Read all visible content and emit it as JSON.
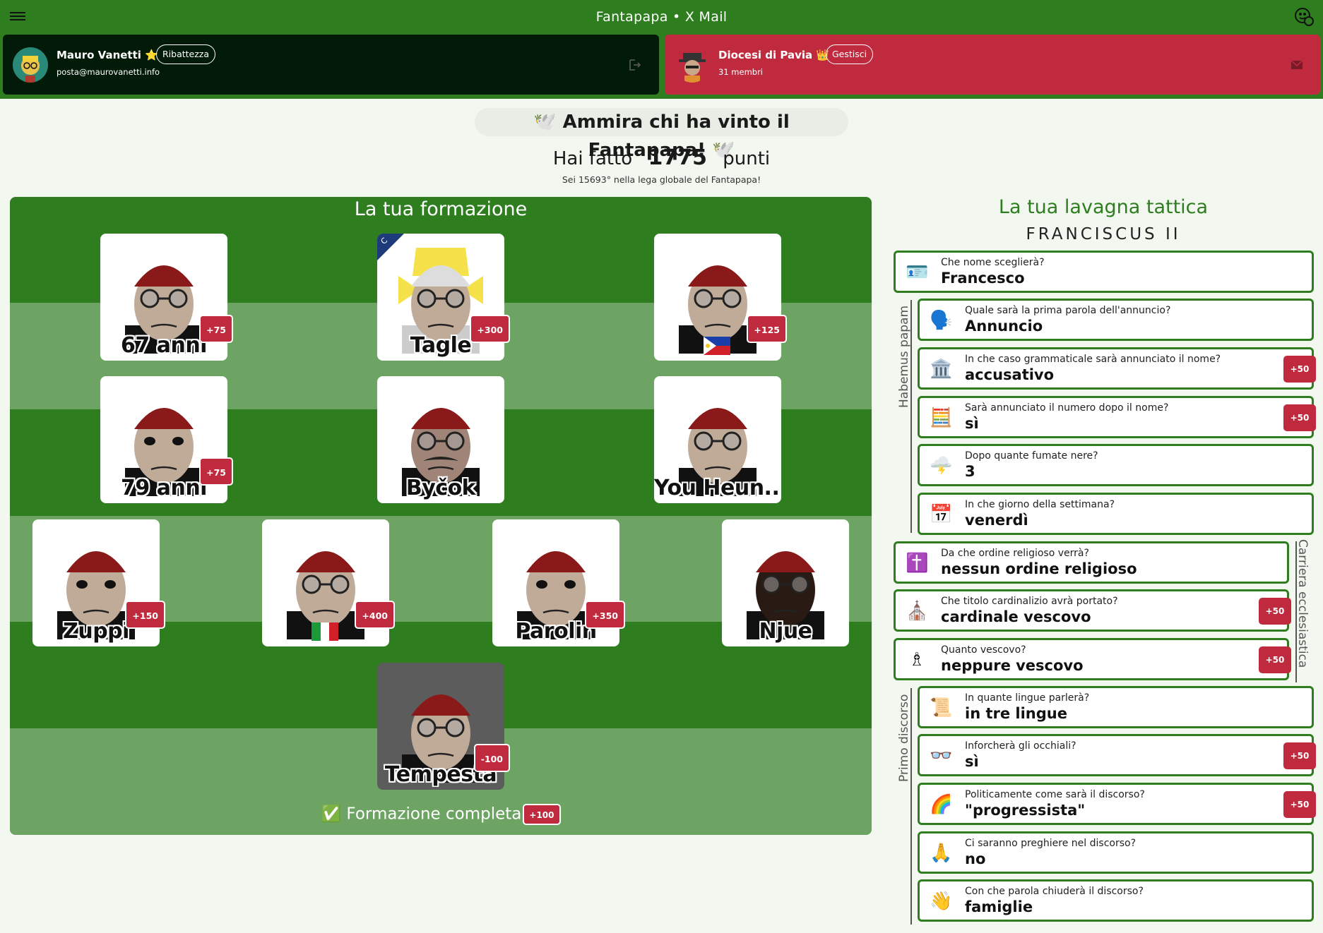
{
  "header": {
    "title": "Fantapapa • X Mail"
  },
  "user": {
    "name": "Mauro Vanetti ⭐",
    "email": "posta@maurovanetti.info",
    "action_label": "Ribattezza"
  },
  "league": {
    "name": "Diocesi di Pavia 👑",
    "members": "31 membri",
    "action_label": "Gestisci"
  },
  "banner": "🕊️ Ammira chi ha vinto il Fantapapa! 🕊️",
  "score": {
    "prefix": "Hai fatto",
    "value": "1775",
    "suffix": "punti",
    "rank_text": "Sei 15693° nella lega globale del Fantapapa!"
  },
  "formation": {
    "title": "La tua formazione",
    "players": [
      {
        "name": "67 anni",
        "points": "+75"
      },
      {
        "name": "Tagle",
        "points": "+300",
        "captain_badge": "C"
      },
      {
        "name": "",
        "points": "+125"
      },
      {
        "name": "79 anni",
        "points": "+75"
      },
      {
        "name": "Byčok",
        "points": ""
      },
      {
        "name": "You Heun...",
        "points": ""
      },
      {
        "name": "Zuppi",
        "points": "+150"
      },
      {
        "name": "",
        "points": "+400"
      },
      {
        "name": "Parolin",
        "points": "+350"
      },
      {
        "name": "Njue",
        "points": ""
      },
      {
        "name": "Tempesta",
        "points": "-100"
      }
    ],
    "complete": {
      "label": "✅ Formazione completa",
      "points": "+100"
    }
  },
  "lavagna": {
    "title": "La tua lavagna tattica",
    "subtitle": "FRANCISCUS II",
    "groups": {
      "habemus": "Habemus papam",
      "carriera": "Carriera ecclesiastica",
      "discorso": "Primo discorso"
    },
    "questions": [
      {
        "icon": "🪪",
        "q": "Che nome sceglierà?",
        "a": "Francesco",
        "bonus": ""
      },
      {
        "icon": "🗣️",
        "q": "Quale sarà la prima parola dell'annuncio?",
        "a": "Annuncio",
        "bonus": ""
      },
      {
        "icon": "🏛️",
        "q": "In che caso grammaticale sarà annunciato il nome?",
        "a": "accusativo",
        "bonus": "+50"
      },
      {
        "icon": "🧮",
        "q": "Sarà annunciato il numero dopo il nome?",
        "a": "sì",
        "bonus": "+50"
      },
      {
        "icon": "🌩️",
        "q": "Dopo quante fumate nere?",
        "a": "3",
        "bonus": ""
      },
      {
        "icon": "📅",
        "q": "In che giorno della settimana?",
        "a": "venerdì",
        "bonus": ""
      },
      {
        "icon": "✝️",
        "q": "Da che ordine religioso verrà?",
        "a": "nessun ordine religioso",
        "bonus": ""
      },
      {
        "icon": "⛪",
        "q": "Che titolo cardinalizio avrà portato?",
        "a": "cardinale vescovo",
        "bonus": "+50"
      },
      {
        "icon": "♗",
        "q": "Quanto vescovo?",
        "a": "neppure vescovo",
        "bonus": "+50"
      },
      {
        "icon": "📜",
        "q": "In quante lingue parlerà?",
        "a": "in tre lingue",
        "bonus": ""
      },
      {
        "icon": "👓",
        "q": "Inforcherà gli occhiali?",
        "a": "sì",
        "bonus": "+50"
      },
      {
        "icon": "🌈",
        "q": "Politicamente come sarà il discorso?",
        "a": "\"progressista\"",
        "bonus": "+50"
      },
      {
        "icon": "🙏",
        "q": "Ci saranno preghiere nel discorso?",
        "a": "no",
        "bonus": ""
      },
      {
        "icon": "👋",
        "q": "Con che parola chiuderà il discorso?",
        "a": "famiglie",
        "bonus": ""
      }
    ]
  },
  "colors": {
    "green": "#2e7d1f",
    "red": "#c02a3e",
    "dark": "#021a08"
  }
}
